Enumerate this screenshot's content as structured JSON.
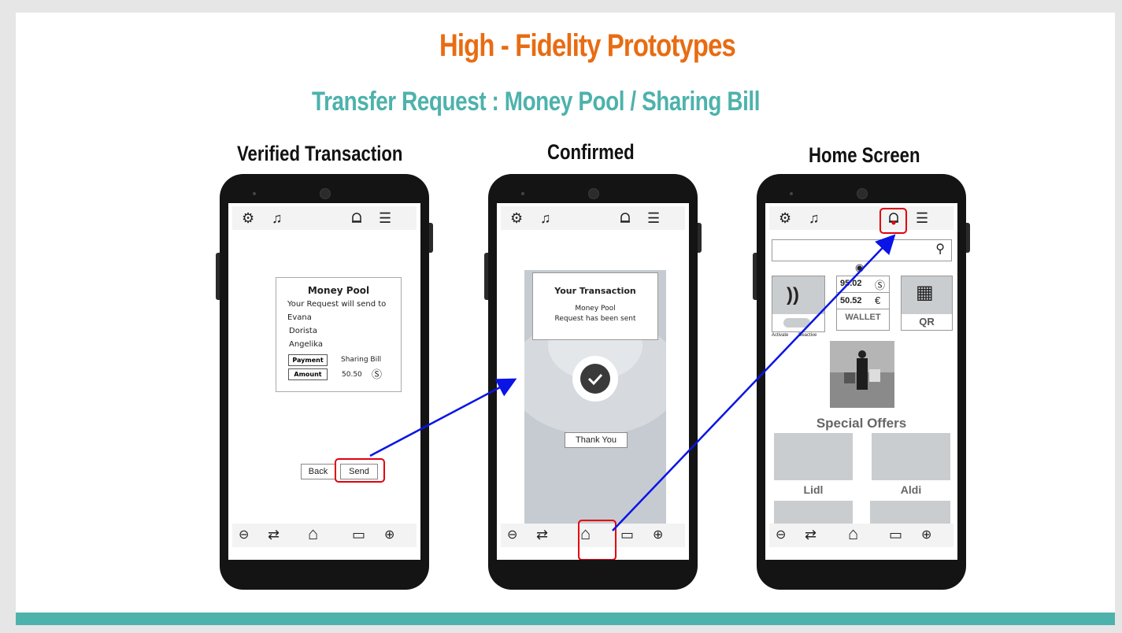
{
  "slide": {
    "title": "High - Fidelity Prototypes",
    "subtitle": "Transfer Request : Money Pool / Sharing Bill"
  },
  "phones": {
    "left": {
      "label": "Verified Transaction",
      "card": {
        "title": "Money Pool",
        "line": "Your Request will send to",
        "recipients": [
          "Evana",
          "Dorista",
          "Angelika"
        ],
        "payment_tag": "Payment",
        "payment_value": "Sharing Bill",
        "amount_tag": "Amount",
        "amount_value": "50.50"
      },
      "back_label": "Back",
      "send_label": "Send"
    },
    "middle": {
      "label": "Confirmed",
      "dialog_title": "Your Transaction",
      "dialog_line1": "Money Pool",
      "dialog_line2": "Request has been sent",
      "thank_you": "Thank You"
    },
    "right": {
      "label": "Home Screen",
      "balance_usd": "95.02",
      "balance_eur": "50.52",
      "wallet_label": "WALLET",
      "qr_label": "QR",
      "activate_label": "Activate",
      "deactive_label": "Deactive",
      "offers_title": "Special Offers",
      "offers": [
        "Lidl",
        "Aldi"
      ]
    }
  },
  "colors": {
    "title": "#e86c12",
    "subtitle": "#4db2ac",
    "footer": "#4db2ac",
    "highlight": "#e3000f",
    "arrow": "#0a14e6"
  }
}
